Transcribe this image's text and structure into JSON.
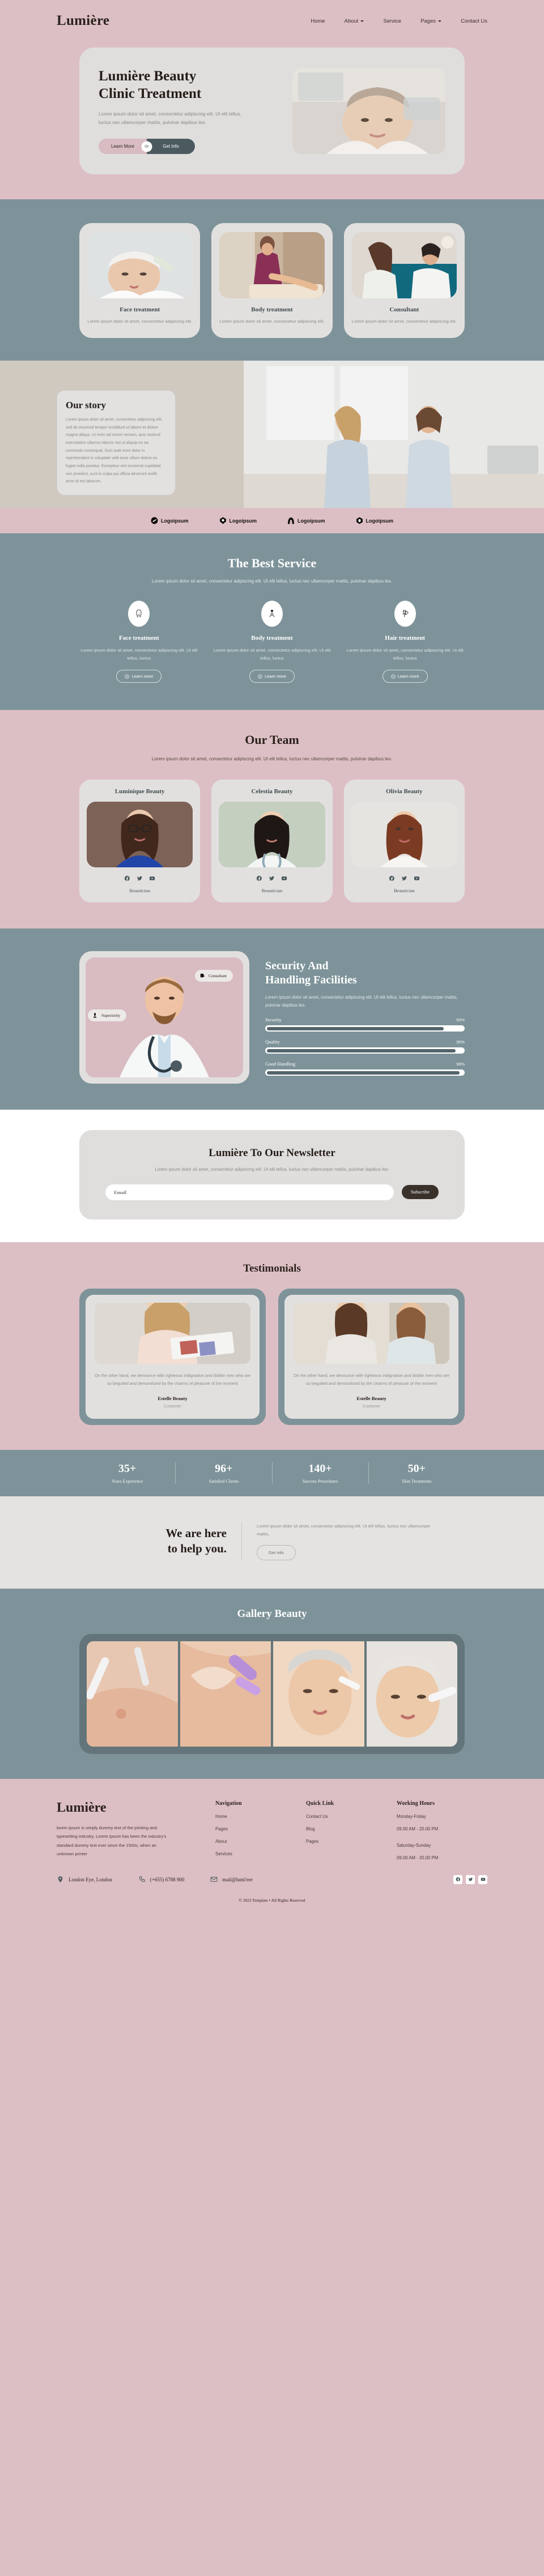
{
  "brand": "Lumière",
  "nav": {
    "items": [
      {
        "label": "Home",
        "caret": false
      },
      {
        "label": "About",
        "caret": true
      },
      {
        "label": "Service",
        "caret": false
      },
      {
        "label": "Pages",
        "caret": true
      },
      {
        "label": "Contact Us",
        "caret": false
      }
    ]
  },
  "hero": {
    "title_line1": "Lumière Beauty",
    "title_line2": "Clinic Treatment",
    "subtitle": "Lorem ipsum dolor sit amet, consectetur adipiscing elit. Ut elit tellus, luctus nec ullamcorper mattis, pulvinar dapibus leo.",
    "cta_primary": "Learn More",
    "cta_or": "Or",
    "cta_secondary": "Get Info"
  },
  "service_cards": [
    {
      "title": "Face treatment",
      "text": "Lorem ipsum dolor sit amet, consectetur adipiscing elit."
    },
    {
      "title": "Body treatment",
      "text": "Lorem ipsum dolor sit amet, consectetur adipiscing elit."
    },
    {
      "title": "Consultant",
      "text": "Lorem ipsum dolor sit amet, consectetur adipiscing elit."
    }
  ],
  "story": {
    "title": "Our story",
    "text": "Lorem ipsum dolor sit amet, consectetur adipiscing elit, sed do eiusmod tempor incididunt ut labore et dolore magna aliqua. Ut enim ad minim veniam, quis nostrud exercitation ullamco laboris nisi ut aliquip ex ea commodo consequat. Duis aute irure dolor in reprehenderit in voluptate velit esse cillum dolore eu fugiat nulla pariatur. Excepteur sint occaecat cupidatat non proident, sunt in culpa qui officia deserunt mollit anim id est laborum."
  },
  "logos": [
    {
      "name": "Logoipsum",
      "shape": "circle-slash"
    },
    {
      "name": "Logoipsum",
      "shape": "shield"
    },
    {
      "name": "Logoipsum",
      "shape": "arch"
    },
    {
      "name": "Logoipsum",
      "shape": "flower"
    }
  ],
  "best": {
    "title": "The Best Service",
    "lead": "Lorem ipsum dolor sit amet, consectetur adipiscing elit. Ut elit tellus, luctus nec ullamcorper mattis, pulvinar dapibus leo.",
    "items": [
      {
        "icon": "face-treatment-icon",
        "title": "Face treatment",
        "text": "Lorem ipsum dolor sit amet, consectetur adipiscing elit. Ut elit tellus, luctus",
        "button": "Learn more"
      },
      {
        "icon": "body-treatment-icon",
        "title": "Body treatment",
        "text": "Lorem ipsum dolor sit amet, consectetur adipiscing elit. Ut elit tellus, luctus",
        "button": "Learn more"
      },
      {
        "icon": "hair-treatment-icon",
        "title": "Hair treatment",
        "text": "Lorem ipsum dolor sit amet, consectetur adipiscing elit. Ut elit tellus, luctus",
        "button": "Learn more"
      }
    ]
  },
  "team": {
    "title": "Our Team",
    "lead": "Lorem ipsum dolor sit amet, consectetur adipiscing elit. Ut elit tellus, luctus nec ullamcorper mattis, pulvinar dapibus leo.",
    "members": [
      {
        "name": "Luminique Beauty",
        "role": "Beautician"
      },
      {
        "name": "Celestia Beauty",
        "role": "Beautician"
      },
      {
        "name": "Olivia Beauty",
        "role": "Beautician"
      }
    ],
    "social_icons": [
      "facebook-icon",
      "twitter-icon",
      "youtube-icon"
    ]
  },
  "security": {
    "title_line1": "Security And",
    "title_line2": "Handling Facilities",
    "lead": "Lorem ipsum dolor sit amet, consectetur adipiscing elit. Ut elit tellus, luctus nec ullamcorper mattis, pulvinar dapibus leo.",
    "badge_consultant": "Consultant",
    "badge_superiority": "Superiority",
    "bars": [
      {
        "label": "Security",
        "pct": "90%",
        "value": 90
      },
      {
        "label": "Quality",
        "pct": "96%",
        "value": 96
      },
      {
        "label": "Good Handling",
        "pct": "98%",
        "value": 98
      }
    ]
  },
  "newsletter": {
    "title": "Lumière To Our Newsletter",
    "text": "Lorem ipsum dolor sit amet, consectetur adipiscing elit. Ut elit tellus, luctus nec ullamcorper mattis, pulvinar dapibus leo.",
    "placeholder": "Email",
    "button": "Subscribe"
  },
  "testimonials": {
    "title": "Testimonials",
    "items": [
      {
        "text": "On the other hand, we denounce with righteous indignation and dislike men who are so beguiled and demoralized by the charms of pleasure of the moment",
        "name": "Estelle Beauty",
        "role": "Customer"
      },
      {
        "text": "On the other hand, we denounce with righteous indignation and dislike men who are so beguiled and demoralized by the charms of pleasure of the moment",
        "name": "Estelle Beauty",
        "role": "Customer"
      }
    ]
  },
  "stats": [
    {
      "num": "35+",
      "label": "Years Experience"
    },
    {
      "num": "96+",
      "label": "Satisfied Clients"
    },
    {
      "num": "140+",
      "label": "Success Procedures"
    },
    {
      "num": "50+",
      "label": "Skin Treatments"
    }
  ],
  "help": {
    "title_line1": "We are here",
    "title_line2": "to help you.",
    "text": "Lorem ipsum dolor sit amet, consectetur adipiscing elit. Ut elit tellus, luctus nec ullamcorper mattis,",
    "button": "Get Info"
  },
  "gallery": {
    "title": "Gallery Beauty"
  },
  "footer": {
    "brand": "Lumière",
    "about": "lorem ipsum is simply dummy text of the printing and typesetting industry. Lorem Ipsum has been the industry's standard dummy text ever since the 1500s, when an unknown printer",
    "navigation": {
      "title": "Navigation",
      "links": [
        "Home",
        "Pages",
        "About",
        "Services"
      ]
    },
    "quicklink": {
      "title": "Quick Link",
      "links": [
        "Contact Us",
        "Blog",
        "Pages"
      ]
    },
    "hours": {
      "title": "Working Hours",
      "rows": [
        "Monday-Friday",
        "09.00 AM - 20.00 PM",
        "Saturday-Sunday",
        "09.00 AM - 20.00 PM"
      ]
    },
    "contact": {
      "address": "London Eye, London",
      "phone": "(+655) 6788 900",
      "email": "mail@lumi'ere"
    },
    "social_icons": [
      "facebook-icon",
      "twitter-icon",
      "youtube-icon"
    ],
    "copyright": "© 2023 Template • All Rights Reserved"
  },
  "colors": {
    "pink": "#dcbfc4",
    "teal": "#7d9399",
    "grey": "#e0dedd",
    "dark": "#3a312b"
  }
}
